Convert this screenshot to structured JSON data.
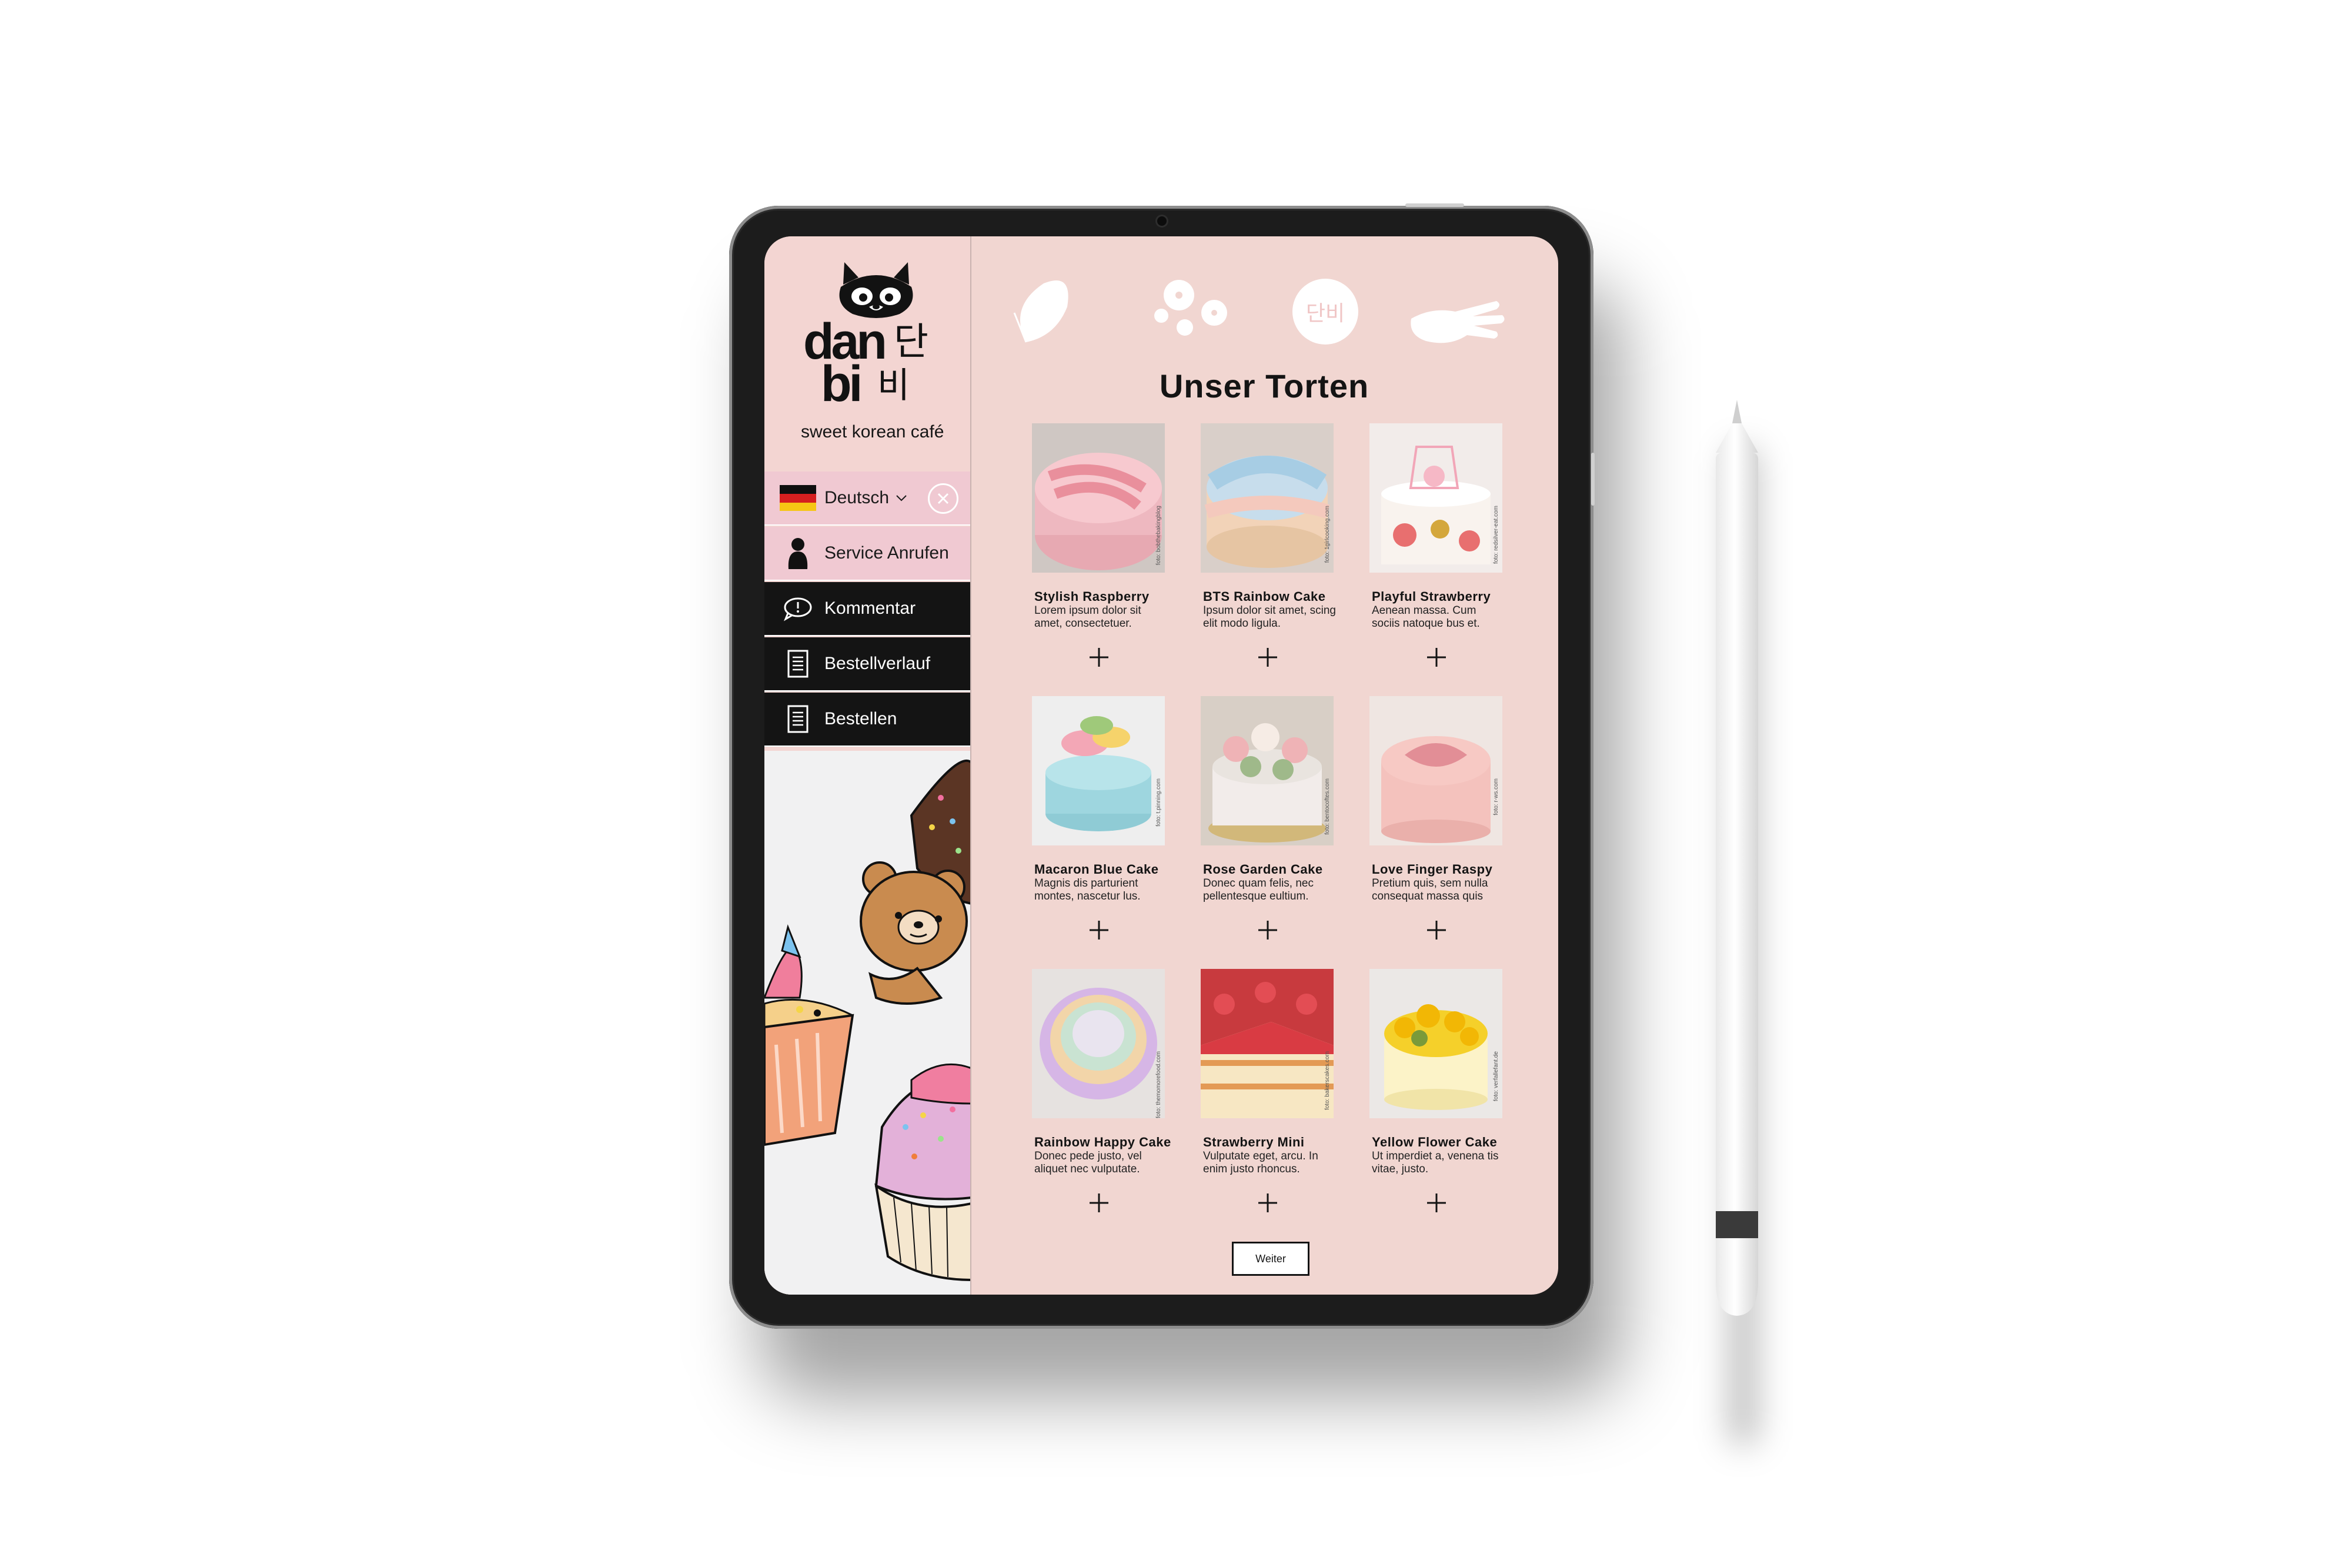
{
  "app": {
    "brand_line1": "dan",
    "brand_line2": "bi",
    "brand_korean1": "단",
    "brand_korean2": "비",
    "tagline": "sweet korean café"
  },
  "sidebar": {
    "language": {
      "label": "Deutsch"
    },
    "items": [
      {
        "label": "Service Anrufen",
        "icon": "person-icon"
      },
      {
        "label": "Kommentar",
        "icon": "comment-icon"
      },
      {
        "label": "Bestellverlauf",
        "icon": "document-icon"
      },
      {
        "label": "Bestellen",
        "icon": "document-icon"
      }
    ]
  },
  "main": {
    "deco_badge": "단비",
    "title": "Unser Torten",
    "next_label": "Weiter",
    "cakes": [
      {
        "name": "Stylish Raspberry",
        "desc": "Lorem ipsum dolor sit amet, consectetuer.",
        "credit": "foto: bobthebakingblog",
        "colors": [
          "#f7c9cf",
          "#e98f9c",
          "#b9b2ae"
        ]
      },
      {
        "name": "BTS Rainbow Cake",
        "desc": "Ipsum dolor sit amet, scing elit modo ligula.",
        "credit": "foto: 1girlcooking.com",
        "colors": [
          "#a7cde4",
          "#f4c9bd",
          "#d8c2a4"
        ]
      },
      {
        "name": "Playful Strawberry",
        "desc": "Aenean massa. Cum sociis natoque bus et.",
        "credit": "foto: redsilver-eat.com",
        "colors": [
          "#f9f3ee",
          "#e86f6f",
          "#d4a73c"
        ]
      },
      {
        "name": "Macaron Blue Cake",
        "desc": "Magnis dis parturient montes, nascetur lus.",
        "credit": "foto: t.pinning.com",
        "colors": [
          "#9ed6df",
          "#f3a7b6",
          "#e9e9e9"
        ]
      },
      {
        "name": "Rose Garden Cake",
        "desc": "Donec quam felis, nec pellentesque eultium.",
        "credit": "foto: bentocoftes.com",
        "colors": [
          "#f2ecea",
          "#efb3b6",
          "#d2b87a"
        ]
      },
      {
        "name": "Love Finger Raspy",
        "desc": "Pretium quis, sem nulla consequat massa quis",
        "credit": "foto: r-ws.com",
        "colors": [
          "#f7c9c4",
          "#e28e96",
          "#f0e6e2"
        ]
      },
      {
        "name": "Rainbow Happy Cake",
        "desc": "Donec pede justo, vel aliquet nec vulputate.",
        "credit": "foto: themomorefood.com",
        "colors": [
          "#c9e3d2",
          "#f2d5a9",
          "#d6b6e6"
        ]
      },
      {
        "name": "Strawberry Mini",
        "desc": "Vulputate eget, arcu. In enim justo rhoncus.",
        "credit": "foto: bakerscakes.com",
        "colors": [
          "#d93b43",
          "#f7e7c3",
          "#e39a55"
        ]
      },
      {
        "name": "Yellow Flower Cake",
        "desc": "Ut imperdiet a, venena tis vitae, justo.",
        "credit": "foto: verfallefant.de",
        "colors": [
          "#f5d02a",
          "#fcf3c8",
          "#e9e9ea"
        ]
      }
    ]
  },
  "theme": {
    "screen_bg": "#f1d6d1",
    "sidebar_bg": "#f3d5d2",
    "nav_light": "#f0c9d2",
    "nav_dark": "#141414",
    "text_dark": "#141414"
  }
}
